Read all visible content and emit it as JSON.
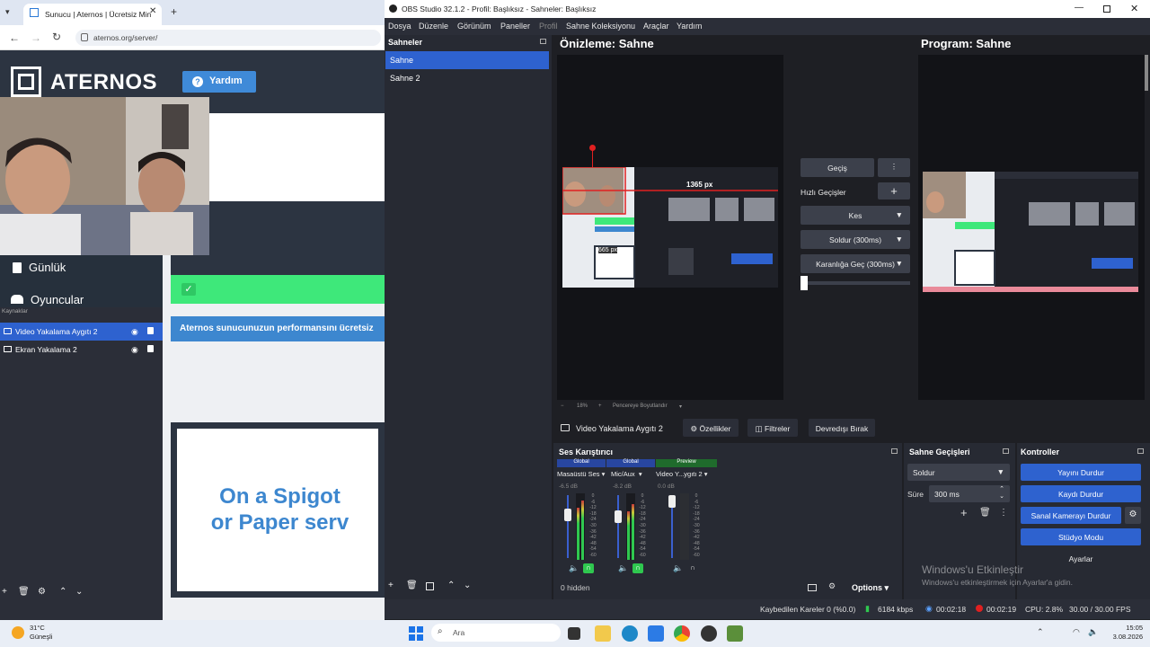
{
  "browser": {
    "tab_title": "Sunucu | Aternos | Ücretsiz Min",
    "url": "aternos.org/server/",
    "logo": "ATERNOS",
    "help_label": "Yardım",
    "nav": [
      "Günlük",
      "Oyuncular"
    ],
    "banner_text": "Aternos sunucunuzun performansını ücretsiz",
    "promo_lines": [
      "On a Spigot",
      "or Paper serv"
    ]
  },
  "sources": {
    "title": "Kaynaklar",
    "items": [
      "Video Yakalama Aygıtı 2",
      "Ekran Yakalama 2"
    ]
  },
  "obs": {
    "window_title": "OBS Studio 32.1.2 - Profil: Başlıksız - Sahneler: Başlıksız",
    "menu": [
      "Dosya",
      "Düzenle",
      "Görünüm",
      "Paneller",
      "Profil",
      "Sahne Koleksiyonu",
      "Araçlar",
      "Yardım"
    ],
    "scenes_title": "Sahneler",
    "scenes": [
      "Sahne",
      "Sahne 2"
    ],
    "preview_title": "Önizleme: Sahne",
    "program_title": "Program: Sahne",
    "preview_px": "1365 px",
    "preview_px2": "665 px",
    "zoom": "18%",
    "fit_label": "Pencereye Boyutlandır",
    "transitions": {
      "gecis": "Geçiş",
      "quick_label": "Hızlı Geçişler",
      "cut": "Kes",
      "fade": "Soldur (300ms)",
      "fade_black": "Karanlığa Geç (300ms)"
    },
    "source_bar": {
      "name": "Video Yakalama Aygıtı 2",
      "props": "Özellikler",
      "filters": "Filtreler",
      "deactivate": "Devredışı Bırak"
    },
    "mixer": {
      "title": "Ses Karıştırıcı",
      "channels": [
        {
          "tag": "Global",
          "name": "Masaüstü Ses",
          "db": "-6.5 dB"
        },
        {
          "tag": "Global",
          "name": "Mic/Aux",
          "db": "-8.2 dB"
        },
        {
          "tag": "Preview",
          "name": "Video Y...ygıtı 2",
          "db": "0.0 dB"
        }
      ],
      "scale": [
        "0",
        "-6",
        "-12",
        "-18",
        "-24",
        "-30",
        "-36",
        "-42",
        "-48",
        "-54",
        "-60"
      ],
      "hidden": "0 hidden",
      "options": "Options"
    },
    "scene_trans": {
      "title": "Sahne Geçişleri",
      "selected": "Soldur",
      "duration_label": "Süre",
      "duration": "300 ms"
    },
    "controls": {
      "title": "Kontroller",
      "buttons": [
        "Yayını Durdur",
        "Kaydı Durdur",
        "Sanal Kamerayı Durdur",
        "Stüdyo Modu",
        "Ayarlar"
      ]
    },
    "watermark": [
      "Windows'u Etkinleştir",
      "Windows'u etkinleştirmek için Ayarlar'a gidin."
    ],
    "status": {
      "dropped": "Kaybedilen Kareler 0 (%0.0)",
      "bitrate": "6184 kbps",
      "stream_time": "00:02:18",
      "rec_time": "00:02:19",
      "cpu": "CPU: 2.8%",
      "fps": "30.00 / 30.00 FPS"
    }
  },
  "taskbar": {
    "weather_temp": "31°C",
    "weather_desc": "Güneşli",
    "search": "Ara",
    "time": "15:05",
    "date": "3.08.2026"
  },
  "colors": {
    "obs_bg": "#1e1f24",
    "obs_blue": "#2e62cf",
    "aternos_blue": "#3d87cf",
    "aternos_green": "#3ee87a"
  }
}
